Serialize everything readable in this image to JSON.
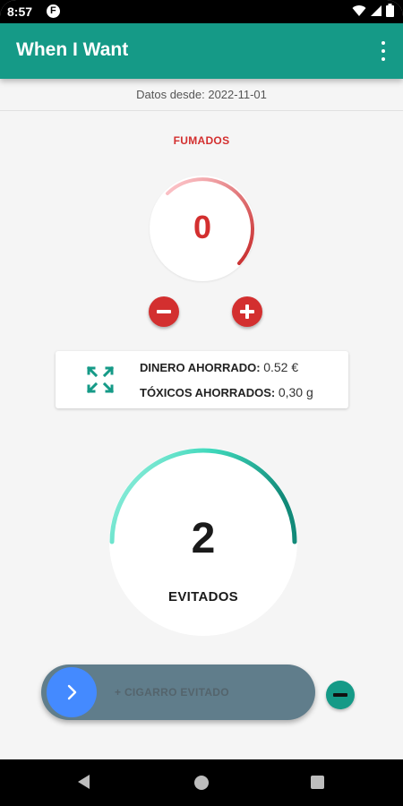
{
  "status_bar": {
    "time": "8:57",
    "app_icon": "f-badge-icon",
    "icons": [
      "wifi-icon",
      "signal-icon",
      "battery-icon"
    ]
  },
  "app_bar": {
    "title": "When I Want",
    "menu_icon": "more-vert-icon"
  },
  "since": {
    "text": "Datos desde: 2022-11-01"
  },
  "smoked": {
    "label": "FUMADOS",
    "value": "0",
    "color": "#d32f2f",
    "minus_icon": "minus-icon",
    "plus_icon": "plus-icon"
  },
  "savings": {
    "icon": "expand-icon",
    "money_label": "DINERO AHORRADO:",
    "money_value": "0.52 €",
    "toxics_label": "TÓXICOS AHORRADOS:",
    "toxics_value": "0,30 g"
  },
  "avoided": {
    "value": "2",
    "label": "EVITADOS",
    "color": "#26bfa3"
  },
  "slider": {
    "text": "+ CIGARRO EVITADO",
    "knob_icon": "chevron-right-icon",
    "minus_icon": "minus-icon"
  },
  "colors": {
    "primary": "#159a87",
    "danger": "#d32f2f",
    "accent": "#448aff",
    "slider": "#607d8b"
  },
  "nav_bar": {
    "icons": [
      "back-icon",
      "home-icon",
      "recents-icon"
    ]
  }
}
